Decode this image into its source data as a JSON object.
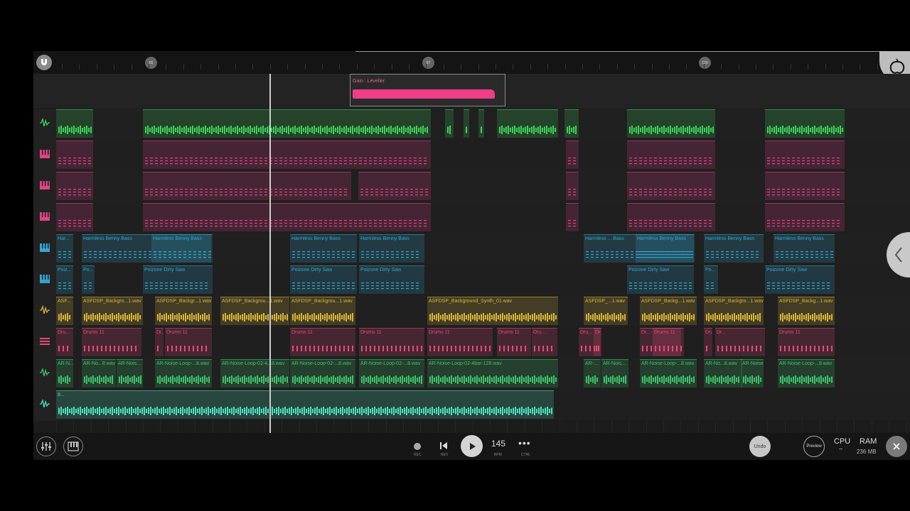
{
  "ruler": {
    "markers": [
      "65",
      "97",
      "129"
    ]
  },
  "automation": {
    "clip_label": "Gain : Leveller"
  },
  "tracks": [
    {
      "id": "t1",
      "type": "audio",
      "color": "#3ed35a",
      "clips": []
    },
    {
      "id": "t2",
      "type": "piano",
      "color": "#e0438a",
      "clips": []
    },
    {
      "id": "t3",
      "type": "piano",
      "color": "#e0438a",
      "clips": []
    },
    {
      "id": "t4",
      "type": "piano",
      "color": "#e0438a",
      "clips": []
    },
    {
      "id": "t5",
      "type": "piano",
      "color": "#33a6cf",
      "labels": [
        "Har...",
        "Harmless Benny Bass",
        "Harmless Benny Bass",
        "Harmless Benny Bass",
        "Harmless Benny Bass",
        "Harmless ... Bass",
        "Harmless Benny Bass",
        "Harmless Benny Bass",
        "Harmless Benny Bass"
      ]
    },
    {
      "id": "t6",
      "type": "piano",
      "color": "#33a6cf",
      "labels": [
        "Poiz...",
        "Po...",
        "Poizone Dirty Saw",
        "Poizone Dirty Saw",
        "Poizone Dirty Saw",
        "Poizone Dirty Saw",
        "Po...",
        "Poizone Dirty Saw"
      ]
    },
    {
      "id": "t7",
      "type": "audio",
      "color": "#d8b53a",
      "labels": [
        "ASF...",
        "ASFDSP_Backgro...1.wav",
        "ASFDSP_Backgr...1.wav",
        "ASFDSP_Backgrou...1.wav",
        "ASFDSP_Backgrou...1.wav",
        "ASFDSP_Background_Synth_01.wav",
        "ASFDSP_...1.wav",
        "ASFDSP_Backg...1.wav",
        "ASFDSP_Backgro...1.wav",
        "ASFDSP_Backg...1.wav"
      ]
    },
    {
      "id": "t8",
      "type": "drums",
      "color": "#e84a7b",
      "labels": [
        "Dru...",
        "Drums 11",
        "Dr...",
        "Drums 11",
        "Drums 11",
        "Drums 11",
        "Drums 11",
        "Drums 11",
        "Dru...",
        "Dru...",
        "Drums 11",
        "Dr...",
        "Drums 11",
        "Drums 11",
        "Dr...",
        "Drums 11"
      ]
    },
    {
      "id": "t9",
      "type": "audio",
      "color": "#3ec46b",
      "labels": [
        "AR-N...",
        "AR-No...8.wav",
        "AR-Nois...",
        "AR-Noise-Loop-...8.wav",
        "AR-Noise-Loop-02-4...8.wav",
        "AR-Noise-Loop-02-...8.wav",
        "AR-Noise-Loop-02-...8.wav",
        "AR-Noise-Loop-02-4bar-128.wav",
        "AR-...",
        "AR-Nois...",
        "AR-Noise-Loop-...8.wav",
        "AR-No...8.wav",
        "AR-Noise...",
        "AR-Noise-Loop-...8.wav"
      ]
    },
    {
      "id": "t10",
      "type": "audio",
      "color": "#4fe0c0",
      "labels": [
        "8..."
      ]
    }
  ],
  "transport": {
    "rec_label": "REC",
    "rev_label": "REV",
    "bpm": "145",
    "bpm_label": "BPM",
    "ctrl_label": "CTRL",
    "undo_label": "Undo",
    "preview_label": "Preview",
    "cpu_label": "CPU",
    "ram_label": "RAM",
    "ram_value": "236 MB"
  }
}
